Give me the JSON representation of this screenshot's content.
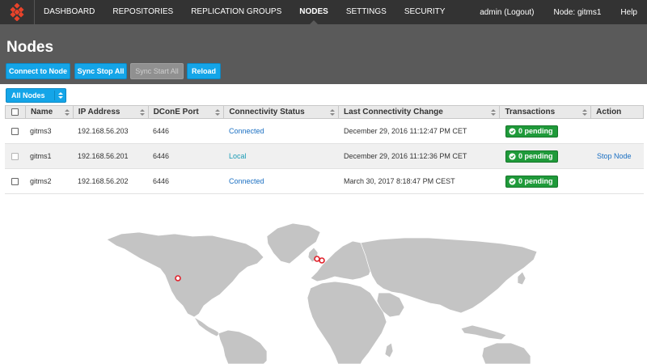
{
  "nav": {
    "items": [
      {
        "label": "DASHBOARD",
        "active": false
      },
      {
        "label": "REPOSITORIES",
        "active": false
      },
      {
        "label": "REPLICATION GROUPS",
        "active": false
      },
      {
        "label": "NODES",
        "active": true
      },
      {
        "label": "SETTINGS",
        "active": false
      },
      {
        "label": "SECURITY",
        "active": false
      }
    ],
    "user": "admin (Logout)",
    "node": "Node: gitms1",
    "help": "Help"
  },
  "page": {
    "title": "Nodes"
  },
  "toolbar": {
    "connect": "Connect to Node",
    "sync_stop_all": "Sync Stop All",
    "sync_start_all": "Sync Start All",
    "reload": "Reload"
  },
  "filter": {
    "selected": "All Nodes"
  },
  "table": {
    "headers": [
      "Name",
      "IP Address",
      "DConE Port",
      "Connectivity Status",
      "Last Connectivity Change",
      "Transactions",
      "Action"
    ],
    "rows": [
      {
        "name": "gitms3",
        "ip": "192.168.56.203",
        "port": "6446",
        "status": "Connected",
        "last_change": "December 29, 2016 11:12:47 PM CET",
        "transactions": "0 pending",
        "action": ""
      },
      {
        "name": "gitms1",
        "ip": "192.168.56.201",
        "port": "6446",
        "status": "Local",
        "last_change": "December 29, 2016 11:12:36 PM CET",
        "transactions": "0 pending",
        "action": "Stop Node"
      },
      {
        "name": "gitms2",
        "ip": "192.168.56.202",
        "port": "6446",
        "status": "Connected",
        "last_change": "March 30, 2017 8:18:47 PM CEST",
        "transactions": "0 pending",
        "action": ""
      }
    ]
  },
  "colors": {
    "nav_bg": "#333333",
    "header_bg": "#5a5a5a",
    "button": "#14a5e8",
    "badge": "#1f9a3a",
    "map_land": "#c4c4c4",
    "map_marker": "#e0202a"
  },
  "icons": {
    "logo": "wandisco-logo-icon",
    "dropdown": "updown-arrow-icon",
    "sort": "sort-icon",
    "badge": "check-circle-icon",
    "map_marker": "location-marker-icon"
  }
}
